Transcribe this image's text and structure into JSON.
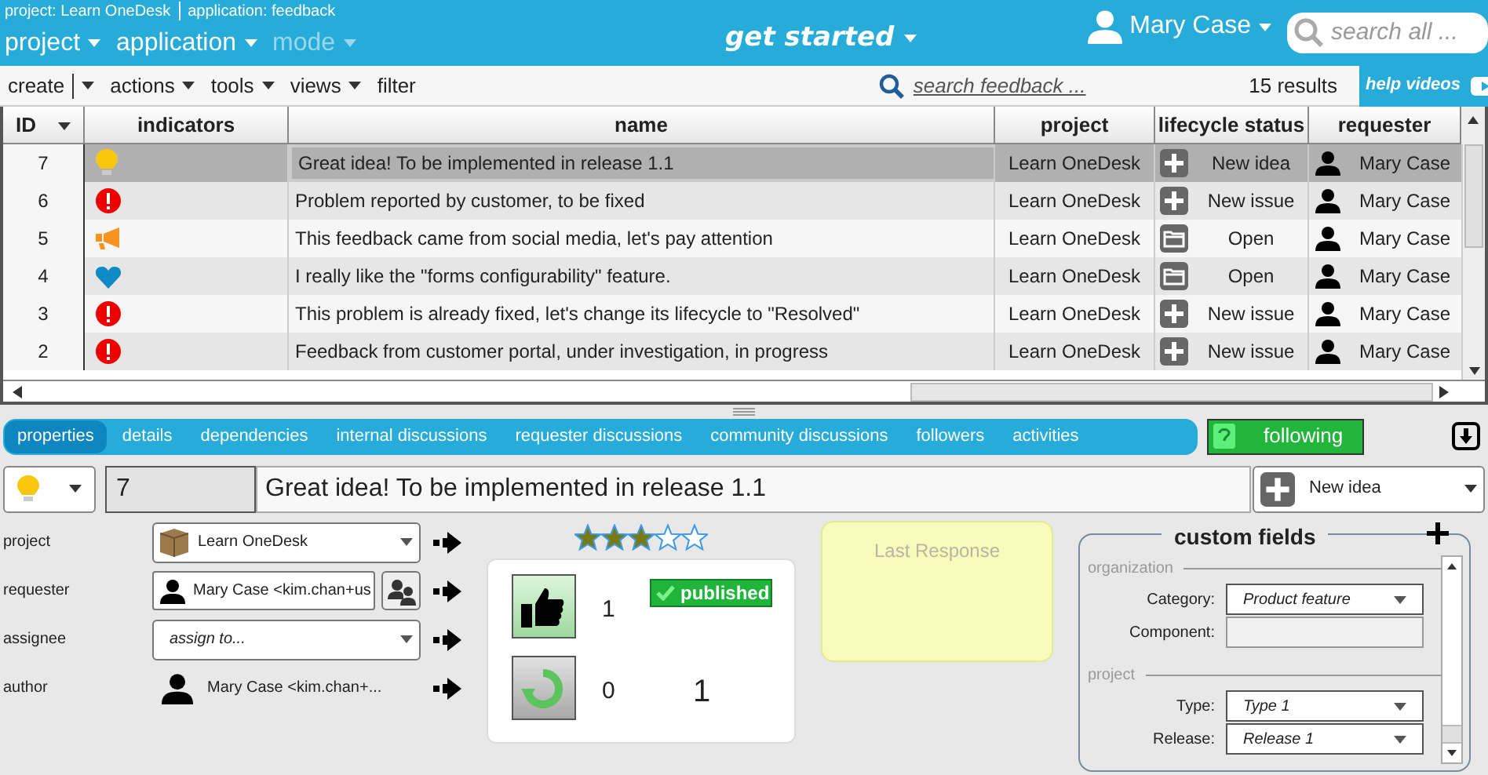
{
  "top_bar": {
    "breadcrumbs": [
      "project: Learn OneDesk",
      "application: feedback"
    ],
    "nav": [
      {
        "label": "project",
        "disabled": false
      },
      {
        "label": "application",
        "disabled": false
      },
      {
        "label": "mode",
        "disabled": true
      }
    ],
    "center": "get started",
    "user": "Mary Case",
    "search": {
      "placeholder": "search all ..."
    }
  },
  "toolbar": {
    "menus": [
      "create",
      "actions",
      "tools",
      "views",
      "filter"
    ],
    "search": {
      "placeholder": "search feedback ..."
    },
    "results": "15 results",
    "help": "help videos"
  },
  "table": {
    "columns": [
      "ID",
      "indicators",
      "name",
      "project",
      "lifecycle status",
      "requester"
    ],
    "rows": [
      {
        "id": "7",
        "indicator": {
          "kind": "idea"
        },
        "name": "Great idea! To be implemented in release 1.1",
        "project": "Learn OneDesk",
        "status": {
          "kind": "new",
          "label": "New idea"
        },
        "requester": "Mary Case",
        "selected": true
      },
      {
        "id": "6",
        "indicator": {
          "kind": "issue"
        },
        "name": "Problem reported by customer, to be fixed",
        "project": "Learn OneDesk",
        "status": {
          "kind": "new",
          "label": "New issue"
        },
        "requester": "Mary Case",
        "selected": false
      },
      {
        "id": "5",
        "indicator": {
          "kind": "social"
        },
        "name": "This feedback came from social media, let's pay attention",
        "project": "Learn OneDesk",
        "status": {
          "kind": "open",
          "label": "Open"
        },
        "requester": "Mary Case",
        "selected": false
      },
      {
        "id": "4",
        "indicator": {
          "kind": "heart"
        },
        "name": "I really like the \"forms configurability\" feature.",
        "project": "Learn OneDesk",
        "status": {
          "kind": "open",
          "label": "Open"
        },
        "requester": "Mary Case",
        "selected": false
      },
      {
        "id": "3",
        "indicator": {
          "kind": "issue"
        },
        "name": "This problem is already fixed, let's change its lifecycle to \"Resolved\"",
        "project": "Learn OneDesk",
        "status": {
          "kind": "new",
          "label": "New issue"
        },
        "requester": "Mary Case",
        "selected": false
      },
      {
        "id": "2",
        "indicator": {
          "kind": "issue"
        },
        "name": "Feedback from customer portal, under investigation, in progress",
        "project": "Learn OneDesk",
        "status": {
          "kind": "new",
          "label": "New issue"
        },
        "requester": "Mary Case",
        "selected": false
      }
    ]
  },
  "tabs": [
    {
      "label": "properties",
      "selected": true
    },
    {
      "label": "details",
      "selected": false
    },
    {
      "label": "dependencies",
      "selected": false
    },
    {
      "label": "internal discussions",
      "selected": false
    },
    {
      "label": "requester discussions",
      "selected": false
    },
    {
      "label": "community discussions",
      "selected": false
    },
    {
      "label": "followers",
      "selected": false
    },
    {
      "label": "activities",
      "selected": false
    }
  ],
  "follow_button": {
    "label": "following",
    "on": true
  },
  "item": {
    "indicator": {
      "kind": "idea"
    },
    "id": "7",
    "title": "Great idea! To be implemented in release 1.1",
    "status": {
      "kind": "new",
      "label": "New idea"
    }
  },
  "form": [
    {
      "label": "project",
      "kind": "select",
      "value": "Learn OneDesk"
    },
    {
      "label": "requester",
      "kind": "person-field",
      "value": "Mary Case <kim.chan+us"
    },
    {
      "label": "assignee",
      "kind": "select",
      "placeholder": "assign to..."
    },
    {
      "label": "author",
      "kind": "person",
      "value": "Mary Case <kim.chan+..."
    }
  ],
  "rating": {
    "stars": 3
  },
  "votes": {
    "up": "1",
    "down": "0",
    "badge": "published",
    "count": "1"
  },
  "last_response": {
    "placeholder": "Last Response"
  },
  "custom_fields": {
    "title": "custom fields",
    "sections": [
      {
        "name": "organization",
        "fields": [
          {
            "label": "Category:",
            "kind": "select",
            "value": "Product feature"
          },
          {
            "label": "Component:",
            "kind": "text"
          }
        ]
      },
      {
        "name": "project",
        "fields": [
          {
            "label": "Type:",
            "kind": "select",
            "value": "Type 1"
          },
          {
            "label": "Release:",
            "kind": "select",
            "value": "Release 1"
          }
        ]
      }
    ]
  }
}
